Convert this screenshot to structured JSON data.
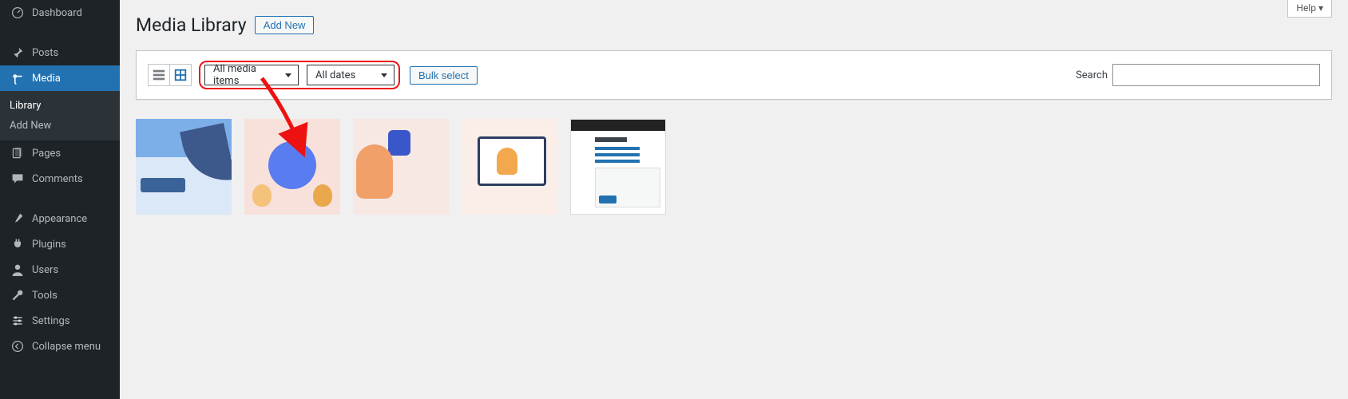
{
  "sidebar": {
    "dashboard": "Dashboard",
    "posts": "Posts",
    "media": "Media",
    "media_sub": {
      "library": "Library",
      "add_new": "Add New"
    },
    "pages": "Pages",
    "comments": "Comments",
    "appearance": "Appearance",
    "plugins": "Plugins",
    "users": "Users",
    "tools": "Tools",
    "settings": "Settings",
    "collapse": "Collapse menu"
  },
  "header": {
    "help": "Help ▾",
    "title": "Media Library",
    "add_new": "Add New"
  },
  "filters": {
    "media_items": "All media items",
    "dates": "All dates",
    "bulk": "Bulk select",
    "search_label": "Search"
  }
}
